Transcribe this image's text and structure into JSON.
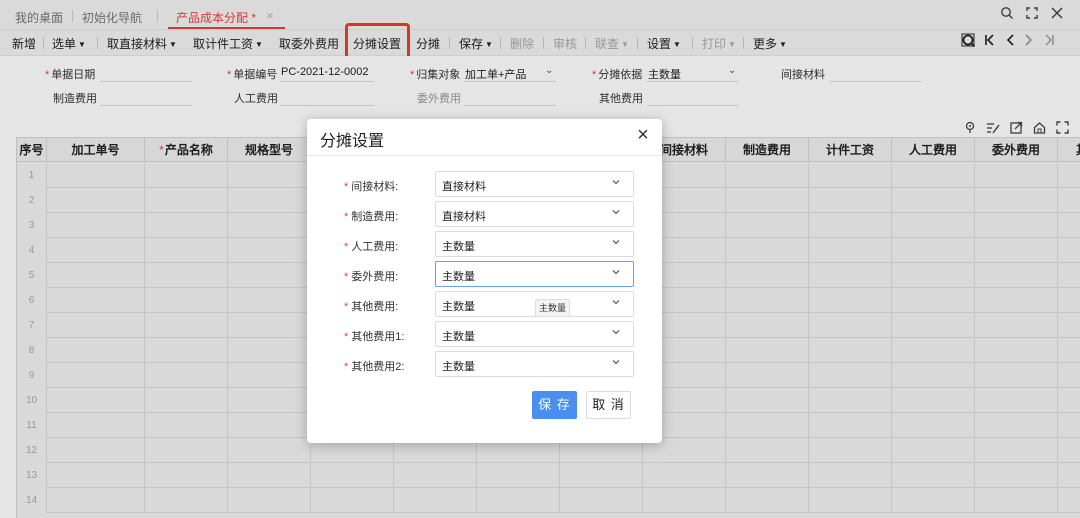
{
  "tabs": [
    {
      "label": "我的桌面",
      "active": false
    },
    {
      "label": "初始化导航",
      "active": false
    },
    {
      "label": "产品成本分配 *",
      "active": true
    }
  ],
  "tab_close_icon": "×",
  "window_controls": [
    "search-icon",
    "fullscreen-icon",
    "close-icon"
  ],
  "toolbar": {
    "items": [
      {
        "label": "新增",
        "dropdown": false,
        "disabled": false
      },
      {
        "label": "选单",
        "dropdown": true,
        "disabled": false
      },
      {
        "label": "取直接材料",
        "dropdown": true,
        "disabled": false
      },
      {
        "label": "取计件工资",
        "dropdown": true,
        "disabled": false
      },
      {
        "label": "取委外费用",
        "dropdown": false,
        "disabled": false
      },
      {
        "label": "分摊设置",
        "dropdown": false,
        "disabled": false
      },
      {
        "label": "分摊",
        "dropdown": false,
        "disabled": false
      },
      {
        "label": "保存",
        "dropdown": true,
        "disabled": false
      },
      {
        "label": "删除",
        "dropdown": false,
        "disabled": true
      },
      {
        "label": "审核",
        "dropdown": false,
        "disabled": true
      },
      {
        "label": "联查",
        "dropdown": true,
        "disabled": true
      },
      {
        "label": "设置",
        "dropdown": true,
        "disabled": false
      },
      {
        "label": "打印",
        "dropdown": true,
        "disabled": true
      },
      {
        "label": "更多",
        "dropdown": true,
        "disabled": false
      }
    ],
    "highlighted": "分摊设置",
    "highlight_color": "#e5412d",
    "nav_icons": [
      "find-icon",
      "first-icon",
      "prev-icon",
      "next-icon",
      "last-icon"
    ]
  },
  "form": {
    "doc_date_label": "单据日期",
    "doc_date_value": "",
    "doc_no_label": "单据编号",
    "doc_no_value": "PC-2021-12-0002",
    "collect_label": "归集对象",
    "collect_value": "加工单+产品",
    "alloc_basis_label": "分摊依据",
    "alloc_basis_value": "主数量",
    "indirect_material_label": "间接材料",
    "mfg_cost_label": "制造费用",
    "labor_cost_label": "人工费用",
    "outsource_cost_label": "委外费用",
    "other_cost_label": "其他费用"
  },
  "grid": {
    "columns": [
      "序号",
      "加工单号",
      "产品名称",
      "规格型号",
      "",
      "",
      "",
      "",
      "间接材料",
      "制造费用",
      "计件工资",
      "人工费用",
      "委外费用",
      "其"
    ],
    "required_columns": [
      "产品名称"
    ],
    "row_numbers": [
      "1",
      "2",
      "3",
      "4",
      "5",
      "6",
      "7",
      "8",
      "9",
      "10",
      "11",
      "12",
      "13",
      "14"
    ]
  },
  "table_tools": [
    "pin-icon",
    "edit-icon",
    "export-icon",
    "home-icon",
    "expand-icon"
  ],
  "dialog": {
    "title": "分摊设置",
    "close_icon": "×",
    "rows": [
      {
        "label": "间接材料:",
        "value": "直接材料"
      },
      {
        "label": "制造费用:",
        "value": "直接材料"
      },
      {
        "label": "人工费用:",
        "value": "主数量"
      },
      {
        "label": "委外费用:",
        "value": "主数量"
      },
      {
        "label": "其他费用:",
        "value": "主数量"
      },
      {
        "label": "其他费用1:",
        "value": "主数量"
      },
      {
        "label": "其他费用2:",
        "value": "主数量"
      }
    ],
    "focused_row": 3,
    "tooltip": "主数量",
    "save_label": "保 存",
    "cancel_label": "取 消",
    "primary_color": "#4a8ff0"
  }
}
